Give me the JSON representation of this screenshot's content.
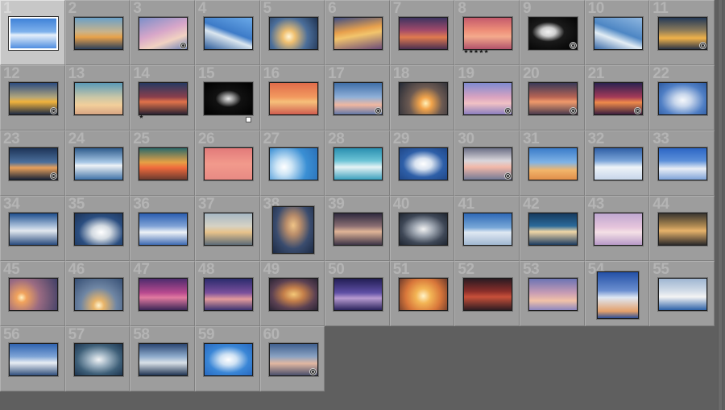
{
  "grid": {
    "selected_index": 1,
    "cells": [
      {
        "num": "1",
        "bg": "linear-gradient(180deg,#3f82d8 0%,#7fb2ec 45%,#e6f0fb 55%,#4f8de0 100%)"
      },
      {
        "num": "2",
        "bg": "linear-gradient(180deg,#6aa0c8 0%,#c9b38a 45%,#e7a14a 62%,#2b3f5a 100%)"
      },
      {
        "num": "3",
        "bg": "linear-gradient(160deg,#7b8fc9 0%,#d7a6c9 45%,#f1d2c2 70%,#6d7fb6 100%)",
        "badge": true
      },
      {
        "num": "4",
        "bg": "linear-gradient(200deg,#6aa9e8 0%,#3d7bc8 45%,#dbe6ef 60%,#2c5b9a 100%)"
      },
      {
        "num": "5",
        "bg": "radial-gradient(circle at 40% 60%,#fff6d8 0%,#f0c070 18%,#4b6e9a 55%,#1f3250 100%)"
      },
      {
        "num": "6",
        "bg": "linear-gradient(170deg,#3c4d85 0%,#e7a04d 40%,#f2c46c 55%,#6b4b78 100%)"
      },
      {
        "num": "7",
        "bg": "linear-gradient(180deg,#3d3460 0%,#a24a6a 40%,#e07a4f 62%,#4a3050 100%)"
      },
      {
        "num": "8",
        "bg": "linear-gradient(180deg,#c45a6c 0%,#ee8e78 40%,#f4a98c 60%,#b1526a 100%)",
        "stars": "★★★★★"
      },
      {
        "num": "9",
        "bg": "radial-gradient(ellipse at 40% 45%,#f2f2f2 0%,#cfcfcf 18%,#1a1a1a 40%,#000 100%)",
        "badge": true
      },
      {
        "num": "10",
        "bg": "linear-gradient(200deg,#8fb7e0 0%,#4d86c4 45%,#e3edf4 65%,#3a6aa8 100%)"
      },
      {
        "num": "11",
        "bg": "linear-gradient(180deg,#243957 0%,#8b7a5a 40%,#f0b24a 65%,#2b3446 100%)",
        "badge": true
      },
      {
        "num": "12",
        "bg": "linear-gradient(180deg,#2c4c80 0%,#b1a57c 45%,#f1b33c 60%,#1f2c45 100%)",
        "badge": true
      },
      {
        "num": "13",
        "bg": "linear-gradient(180deg,#5a9ab8 0%,#c9c6a7 45%,#f2cf9b 70%,#d7a583 100%)"
      },
      {
        "num": "14",
        "bg": "linear-gradient(180deg,#263a62 0%,#8a3f4c 45%,#e1734a 60%,#2a2232 100%)",
        "stars": "★"
      },
      {
        "num": "15",
        "bg": "radial-gradient(ellipse at 50% 50%,#e8e8e8 0%,#9a9a9a 15%,#111 38%,#000 100%)",
        "flag": true
      },
      {
        "num": "16",
        "bg": "linear-gradient(180deg,#e16c4a 0%,#f29a5f 45%,#f6c07a 60%,#d05d4f 100%)"
      },
      {
        "num": "17",
        "bg": "linear-gradient(180deg,#3f6ea8 0%,#8fb0d8 45%,#f0b7a0 70%,#6278a8 100%)",
        "badge": true
      },
      {
        "num": "18",
        "bg": "radial-gradient(circle at 55% 65%,#fff1b8 0%,#f2a44b 18%,#6c5a52 50%,#232a36 100%)"
      },
      {
        "num": "19",
        "bg": "linear-gradient(180deg,#7f8bd2 0%,#d9a3c0 45%,#f1c1c4 65%,#8b7fbf 100%)",
        "badge": true
      },
      {
        "num": "20",
        "bg": "linear-gradient(180deg,#3a3a58 0%,#b86454 45%,#f09a6b 60%,#4a3b4e 100%)",
        "badge": true
      },
      {
        "num": "21",
        "bg": "linear-gradient(180deg,#2b2250 0%,#a43a58 45%,#ef8a4a 62%,#3c1f3f 100%)",
        "badge": true
      },
      {
        "num": "22",
        "bg": "radial-gradient(ellipse at 50% 55%,#f6f8fb 0%,#c9d7ec 25%,#4f7ec4 65%,#2d5aa0 100%)"
      },
      {
        "num": "23",
        "bg": "linear-gradient(180deg,#1e3558 0%,#4b6f9c 45%,#e8a05b 62%,#1a2438 100%)",
        "badge": true
      },
      {
        "num": "24",
        "bg": "linear-gradient(180deg,#2f5c8c 0%,#a8c8e6 45%,#eef2f6 55%,#3f72a8 100%)"
      },
      {
        "num": "25",
        "bg": "linear-gradient(180deg,#2d6b6a 0%,#e6a045 45%,#f06a3c 62%,#6b3a2f 100%)"
      },
      {
        "num": "26",
        "bg": "linear-gradient(180deg,#e27a7a 0%,#f29a8c 50%,#e88a84 100%)"
      },
      {
        "num": "27",
        "bg": "radial-gradient(circle at 30% 60%,#ffffff 0%,#cfe6f6 20%,#3a8fd4 60%,#2a70b8 100%)"
      },
      {
        "num": "28",
        "bg": "linear-gradient(180deg,#2a8fb0 0%,#6cc4d6 40%,#e6f3f5 60%,#3aa0bd 100%)"
      },
      {
        "num": "29",
        "bg": "radial-gradient(ellipse at 50% 50%,#ffffff 0%,#d9e3f0 25%,#2e5fa8 60%,#1f4788 100%)"
      },
      {
        "num": "30",
        "bg": "linear-gradient(180deg,#6b6f86 0%,#d9d6db 40%,#f2b8a8 60%,#737a96 100%)",
        "badge": true
      },
      {
        "num": "31",
        "bg": "linear-gradient(180deg,#3b7cc9 0%,#7fb3e6 45%,#f2b56a 70%,#e08e4a 100%)"
      },
      {
        "num": "32",
        "bg": "linear-gradient(180deg,#2f5fa6 0%,#7aa4d8 40%,#eef3f8 60%,#c7d6ea 100%)"
      },
      {
        "num": "33",
        "bg": "linear-gradient(180deg,#2d66c4 0%,#5b8fd9 40%,#e9eef6 65%,#7fa3d8 100%)"
      },
      {
        "num": "34",
        "bg": "linear-gradient(180deg,#1f4f8e 0%,#a9bfd9 40%,#e2e8ef 55%,#2a4c7e 100%)"
      },
      {
        "num": "35",
        "bg": "radial-gradient(ellipse at 55% 60%,#ffffff 0%,#d4dbe2 25%,#2b4e80 60%,#1b3358 100%)"
      },
      {
        "num": "36",
        "bg": "linear-gradient(180deg,#2a5db0 0%,#7fa2d6 40%,#eef2f7 60%,#3e6ab2 100%)"
      },
      {
        "num": "37",
        "bg": "linear-gradient(180deg,#a6b7c4 0%,#d6d2c4 40%,#e7c28a 60%,#5e6c78 100%)"
      },
      {
        "num": "38",
        "bg": "radial-gradient(ellipse at 50% 40%,#f0c487 0%,#b88c6a 25%,#3a4c6e 60%,#1c2a44 100%)",
        "portrait": true
      },
      {
        "num": "39",
        "bg": "linear-gradient(180deg,#2f2a3f 0%,#8a6e72 40%,#e0b497 58%,#3d3447 100%)"
      },
      {
        "num": "40",
        "bg": "radial-gradient(ellipse at 50% 50%,#f2f2f2 0%,#9ea6b1 30%,#3e4756 65%,#1f2631 100%)"
      },
      {
        "num": "41",
        "bg": "linear-gradient(180deg,#2d68b6 0%,#78a8d8 45%,#dfe8f2 60%,#a1b8d2 100%)"
      },
      {
        "num": "42",
        "bg": "linear-gradient(180deg,#163a5e 0%,#2b6a9a 40%,#f0d6a6 58%,#1d3c60 100%)"
      },
      {
        "num": "43",
        "bg": "linear-gradient(180deg,#bfa7d1 0%,#e7c6dc 45%,#f4e0e6 60%,#b89ac8 100%)"
      },
      {
        "num": "44",
        "bg": "linear-gradient(180deg,#3a3630 0%,#b08a52 40%,#e7b36b 55%,#2c2a2a 100%)"
      },
      {
        "num": "45",
        "bg": "radial-gradient(circle at 25% 60%,#fff0c0 0%,#f1a35d 12%,#9a6b82 45%,#3e3f66 100%)"
      },
      {
        "num": "46",
        "bg": "radial-gradient(circle at 50% 85%,#fff4cf 0%,#e9b56a 15%,#6f86a4 50%,#354e74 100%)"
      },
      {
        "num": "47",
        "bg": "linear-gradient(180deg,#4e2c6e 0%,#b94a8f 45%,#e17aa0 60%,#3a2656 100%)"
      },
      {
        "num": "48",
        "bg": "linear-gradient(180deg,#2b2c6e 0%,#7a4f9c 45%,#e39a9c 65%,#3b3372 100%)"
      },
      {
        "num": "49",
        "bg": "radial-gradient(ellipse at 50% 50%,#f4c777 0%,#c47f4a 30%,#5b4152 65%,#2a2435 100%)"
      },
      {
        "num": "50",
        "bg": "linear-gradient(180deg,#231f55 0%,#5f4fa5 45%,#b79ad0 62%,#2a235c 100%)"
      },
      {
        "num": "51",
        "bg": "radial-gradient(circle at 50% 55%,#fff3c8 0%,#f3b555 25%,#d8763a 60%,#6d3b2c 100%)"
      },
      {
        "num": "52",
        "bg": "linear-gradient(180deg,#2b1b22 0%,#8a2e2a 40%,#c8503a 58%,#2e1c22 100%)"
      },
      {
        "num": "53",
        "bg": "linear-gradient(180deg,#6b74b4 0%,#c79cb4 45%,#f1c2a8 70%,#8c86c0 100%)"
      },
      {
        "num": "54",
        "bg": "linear-gradient(180deg,#2350a6 0%,#6b8fd0 40%,#dfe7f4 55%,#e3a06a 85%,#2a4e98 100%)",
        "portrait": true
      },
      {
        "num": "55",
        "bg": "linear-gradient(180deg,#9fb6d2 0%,#d3dde8 40%,#f4f4f4 58%,#2d62a8 100%)"
      },
      {
        "num": "56",
        "bg": "linear-gradient(180deg,#2f63b0 0%,#7ea4d6 40%,#e9eef4 60%,#314f7c 100%)"
      },
      {
        "num": "57",
        "bg": "radial-gradient(ellipse at 50% 50%,#f2f4f6 0%,#9bb0c0 30%,#3e5f78 65%,#1d3550 100%)"
      },
      {
        "num": "58",
        "bg": "linear-gradient(180deg,#2b4672 0%,#8eabcc 40%,#d9e1e8 60%,#1f3352 100%)"
      },
      {
        "num": "59",
        "bg": "radial-gradient(ellipse at 50% 50%,#ffffff 0%,#cfe2f4 25%,#3a86d6 60%,#2668c0 100%)"
      },
      {
        "num": "60",
        "bg": "linear-gradient(180deg,#3f5f8f 0%,#8aa2c2 40%,#e1b7a1 62%,#4b4f6c 100%)",
        "badge": true
      }
    ]
  }
}
